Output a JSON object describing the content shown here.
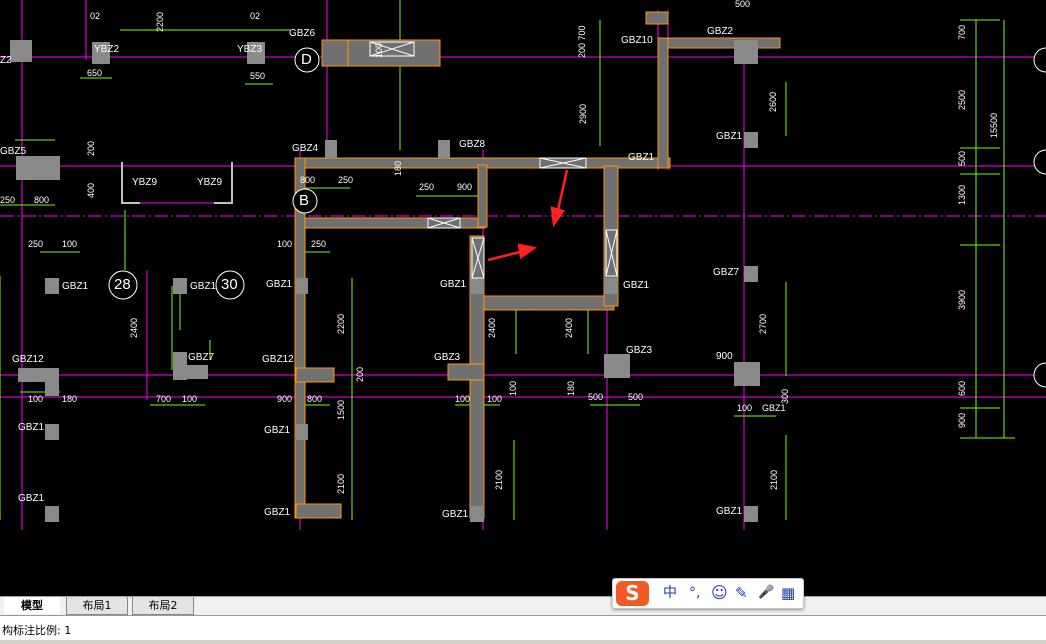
{
  "drawing": {
    "bubbles": [
      {
        "id": "b1",
        "text": "D"
      },
      {
        "id": "b2",
        "text": "B"
      },
      {
        "id": "b3",
        "text": "28"
      },
      {
        "id": "b4",
        "text": "30"
      }
    ],
    "labels": [
      {
        "id": "l1",
        "text": "02"
      },
      {
        "id": "l2",
        "text": "2200"
      },
      {
        "id": "l3",
        "text": "02"
      },
      {
        "id": "l4",
        "text": "GBZ6"
      },
      {
        "id": "l5",
        "text": "YBZ2"
      },
      {
        "id": "l6",
        "text": "YBZ3"
      },
      {
        "id": "l7",
        "text": "650"
      },
      {
        "id": "l8",
        "text": "550"
      },
      {
        "id": "l9",
        "text": "Z2"
      },
      {
        "id": "l10",
        "text": "GBZ10"
      },
      {
        "id": "l11",
        "text": "GBZ2"
      },
      {
        "id": "l12",
        "text": "500"
      },
      {
        "id": "l13",
        "text": "GBZ5"
      },
      {
        "id": "l14",
        "text": "250"
      },
      {
        "id": "l15",
        "text": "800"
      },
      {
        "id": "l16",
        "text": "YBZ9"
      },
      {
        "id": "l17",
        "text": "YBZ9"
      },
      {
        "id": "l18",
        "text": "GBZ4"
      },
      {
        "id": "l19",
        "text": "GBZ8"
      },
      {
        "id": "l20",
        "text": "800"
      },
      {
        "id": "l21",
        "text": "250"
      },
      {
        "id": "l22",
        "text": "250"
      },
      {
        "id": "l23",
        "text": "900"
      },
      {
        "id": "l24",
        "text": "GBZ1"
      },
      {
        "id": "l25",
        "text": "GBZ1"
      },
      {
        "id": "l26",
        "text": "250"
      },
      {
        "id": "l27",
        "text": "100"
      },
      {
        "id": "l28",
        "text": "100"
      },
      {
        "id": "l29",
        "text": "250"
      },
      {
        "id": "l30",
        "text": "GBZ1"
      },
      {
        "id": "l31",
        "text": "GBZ1"
      },
      {
        "id": "l32",
        "text": "GBZ1"
      },
      {
        "id": "l33",
        "text": "GBZ1"
      },
      {
        "id": "l34",
        "text": "GBZ1"
      },
      {
        "id": "l35",
        "text": "GBZ7"
      },
      {
        "id": "l36",
        "text": "GBZ12"
      },
      {
        "id": "l37",
        "text": "GBZ7"
      },
      {
        "id": "l38",
        "text": "GBZ12"
      },
      {
        "id": "l39",
        "text": "GBZ3"
      },
      {
        "id": "l40",
        "text": "GBZ3"
      },
      {
        "id": "l41",
        "text": "900"
      },
      {
        "id": "l42",
        "text": "100"
      },
      {
        "id": "l43",
        "text": "180"
      },
      {
        "id": "l44",
        "text": "700"
      },
      {
        "id": "l45",
        "text": "100"
      },
      {
        "id": "l46",
        "text": "900"
      },
      {
        "id": "l47",
        "text": "800"
      },
      {
        "id": "l48",
        "text": "100"
      },
      {
        "id": "l49",
        "text": "100"
      },
      {
        "id": "l50",
        "text": "500"
      },
      {
        "id": "l51",
        "text": "500"
      },
      {
        "id": "l52",
        "text": "100"
      },
      {
        "id": "l53",
        "text": "GBZ1"
      },
      {
        "id": "l54",
        "text": "GBZ1"
      },
      {
        "id": "l55",
        "text": "GBZ1"
      },
      {
        "id": "l56",
        "text": "GBZ1"
      },
      {
        "id": "l57",
        "text": "GBZ1"
      },
      {
        "id": "l58",
        "text": "GBZ1"
      },
      {
        "id": "l59",
        "text": "GBZ1"
      }
    ],
    "vertical_dims": [
      {
        "id": "v1",
        "text": "200"
      },
      {
        "id": "v2",
        "text": "400"
      },
      {
        "id": "v3",
        "text": "200 700"
      },
      {
        "id": "v4",
        "text": "2900"
      },
      {
        "id": "v5",
        "text": "2600"
      },
      {
        "id": "v6",
        "text": "700"
      },
      {
        "id": "v7",
        "text": "2500"
      },
      {
        "id": "v8",
        "text": "15500"
      },
      {
        "id": "v9",
        "text": "500"
      },
      {
        "id": "v10",
        "text": "1300"
      },
      {
        "id": "v11",
        "text": "3900"
      },
      {
        "id": "v12",
        "text": "2400"
      },
      {
        "id": "v13",
        "text": "2200"
      },
      {
        "id": "v14",
        "text": "200"
      },
      {
        "id": "v15",
        "text": "1500"
      },
      {
        "id": "v16",
        "text": "2100"
      },
      {
        "id": "v17",
        "text": "2400"
      },
      {
        "id": "v18",
        "text": "2400"
      },
      {
        "id": "v19",
        "text": "100"
      },
      {
        "id": "v20",
        "text": "180"
      },
      {
        "id": "v21",
        "text": "2100"
      },
      {
        "id": "v22",
        "text": "2700"
      },
      {
        "id": "v23",
        "text": "300"
      },
      {
        "id": "v24",
        "text": "2100"
      },
      {
        "id": "v25",
        "text": "600"
      },
      {
        "id": "v26",
        "text": "900"
      },
      {
        "id": "v27",
        "text": "180"
      },
      {
        "id": "v28",
        "text": "100"
      }
    ]
  },
  "tabs": [
    {
      "label": "模型"
    },
    {
      "label": "布局1"
    },
    {
      "label": "布局2"
    }
  ],
  "command_line": {
    "text": "构标注比例: 1"
  },
  "ime": {
    "logo": "S",
    "items": [
      {
        "name": "chinese-mode",
        "glyph": "中"
      },
      {
        "name": "punctuation",
        "glyph": "°,"
      },
      {
        "name": "emoji",
        "glyph": "☺"
      },
      {
        "name": "pen",
        "glyph": "✎"
      },
      {
        "name": "voice",
        "glyph": "🎤"
      },
      {
        "name": "toolbox",
        "glyph": "▦"
      }
    ]
  },
  "colors": {
    "wall_fill": "#707070",
    "wall_outline": "#ff9900",
    "axis_line": "#ff00ff",
    "dimension_line": "#7cfc00",
    "arrow": "#ff2020"
  }
}
